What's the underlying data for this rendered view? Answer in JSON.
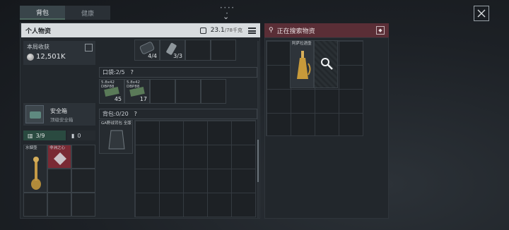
{
  "tabs": [
    {
      "label": "背包",
      "active": true
    },
    {
      "label": "健康",
      "active": false
    }
  ],
  "panel": {
    "title": "个人物资",
    "weight": "23.1",
    "weight_max": "/78千克"
  },
  "earnings": {
    "label": "本局收获",
    "value": "12,501K"
  },
  "top_items": [
    {
      "qty": "4/4"
    },
    {
      "qty": "3/3"
    }
  ],
  "pocket": {
    "label": "口袋:",
    "count": "2/5",
    "help": "?",
    "items": [
      {
        "name": "5.8x42 DBP88",
        "qty": "45"
      },
      {
        "name": "5.8x42 DBP88",
        "qty": "17"
      }
    ]
  },
  "backpack": {
    "label": "背包:",
    "count": "0/20",
    "help": "?",
    "item": "GA野战背包 全版"
  },
  "safebox": {
    "name": "安全箱",
    "sub": "顶级安全箱"
  },
  "safebox_counts": {
    "slots": "3/9",
    "other": "0"
  },
  "safe_items": [
    {
      "name": "水烟壶"
    },
    {
      "name": "非洲之心"
    }
  ],
  "search": {
    "title": "正在搜索物资",
    "item": "阿萨拉酒壶"
  },
  "colors": {
    "accent": "#4e6a60",
    "search_header": "#5a2e36",
    "rare_item": "#7a2a34"
  }
}
